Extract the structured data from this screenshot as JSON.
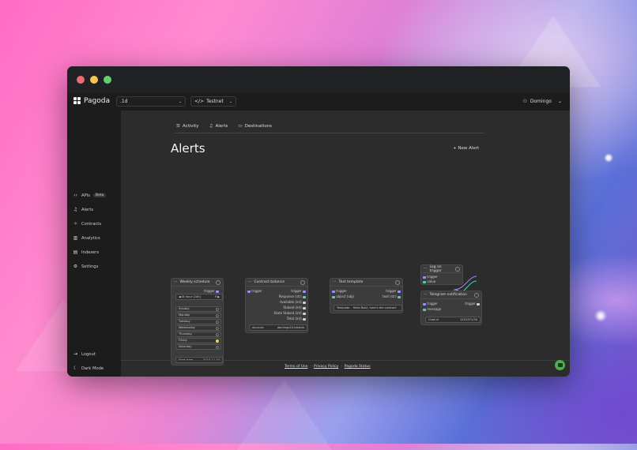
{
  "app": {
    "logo_text": "Pagoda",
    "project_select": ".1d",
    "network_select": "Testnet",
    "user_name": "Domingo"
  },
  "sidebar": {
    "items": [
      {
        "icon": "code-icon",
        "label": "APIs",
        "badge": "Beta"
      },
      {
        "icon": "bell-icon",
        "label": "Alerts"
      },
      {
        "icon": "contracts-icon",
        "label": "Contracts"
      },
      {
        "icon": "chart-icon",
        "label": "Analytics"
      },
      {
        "icon": "indexer-icon",
        "label": "Indexers"
      },
      {
        "icon": "gear-icon",
        "label": "Settings"
      }
    ],
    "logout": "Logout",
    "dark_mode": "Dark Mode"
  },
  "tabs": [
    {
      "label": "Activity"
    },
    {
      "label": "Alerts"
    },
    {
      "label": "Destinations"
    }
  ],
  "page": {
    "title": "Alerts",
    "new_alert": "+ New Alert"
  },
  "nodes": {
    "weekly": {
      "title": "Weekly schedule",
      "trigger": "trigger",
      "timezone": "At hour (24h)",
      "hour": "9",
      "days": [
        "Sunday",
        "Monday",
        "Tuesday",
        "Wednesday",
        "Thursday",
        "Friday",
        "Saturday"
      ],
      "start_label": "Start from",
      "start_value": "2022-11-24"
    },
    "contract": {
      "title": "Contract balance",
      "in_trigger": "trigger",
      "outputs": [
        "trigger",
        "Response (str)",
        "Available (int)",
        "Staked (int)",
        "State Staked (int)",
        "Total (int)"
      ],
      "account_label": "Account",
      "account_value": "domingo10.testnet"
    },
    "text": {
      "title": "Text template",
      "inputs": [
        "trigger",
        "object (obj)"
      ],
      "outputs": [
        "trigger",
        "text (str)"
      ],
      "template_label": "Template",
      "template_value": "Hello Bob!, here's the contract"
    },
    "log": {
      "title": "Log on trigger",
      "inputs": [
        "trigger",
        "value"
      ]
    },
    "telegram": {
      "title": "Telegram notification",
      "inputs": [
        "trigger",
        "message"
      ],
      "output": "trigger",
      "chat_label": "Chat id",
      "chat_value": "2231971/30"
    }
  },
  "footer": {
    "terms": "Terms of Use",
    "privacy": "Privacy Policy",
    "status": "Pagoda Status"
  },
  "colors": {
    "edge_purple": "#9d8cff",
    "edge_green": "#4ad9a0",
    "chat_button": "#4caf50"
  }
}
